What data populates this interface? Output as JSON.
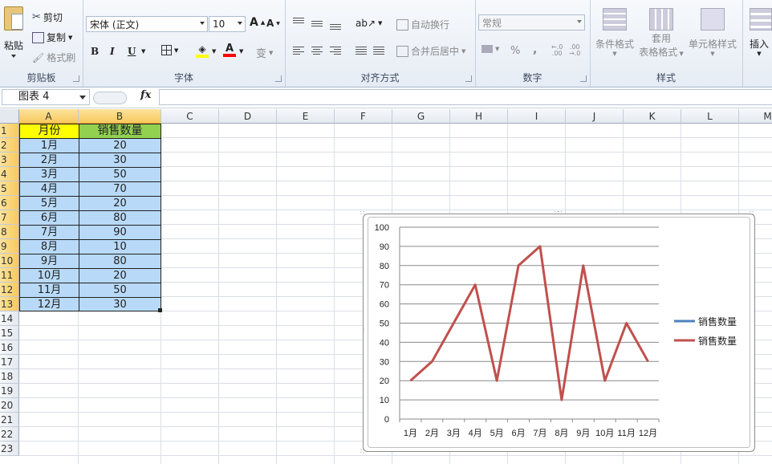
{
  "ribbon": {
    "clipboard": {
      "paste": "粘贴",
      "cut": "剪切",
      "copy": "复制",
      "format_painter": "格式刷",
      "group": "剪贴板"
    },
    "font": {
      "name": "宋体 (正文)",
      "size": "10",
      "bold": "B",
      "italic": "I",
      "underline": "U",
      "phonetic": "变",
      "group": "字体",
      "fill_color": "#ffff00",
      "font_color": "#ff0000"
    },
    "alignment": {
      "wrap": "自动换行",
      "merge": "合并后居中",
      "group": "对齐方式"
    },
    "number": {
      "format": "常规",
      "percent": "%",
      "comma": ",",
      "group": "数字"
    },
    "styles": {
      "conditional": "条件格式",
      "table_line1": "套用",
      "table_line2": "表格格式",
      "cell_styles": "单元格样式",
      "group": "样式"
    },
    "cells": {
      "insert": "插入"
    }
  },
  "formula_bar": {
    "name_box": "图表 4",
    "fx": "fx",
    "formula": ""
  },
  "columns": [
    "A",
    "B",
    "C",
    "D",
    "E",
    "F",
    "G",
    "H",
    "I",
    "J",
    "K",
    "L",
    "M"
  ],
  "rows": [
    "1",
    "2",
    "3",
    "4",
    "5",
    "6",
    "7",
    "8",
    "9",
    "10",
    "11",
    "12",
    "13",
    "14",
    "15",
    "16",
    "17",
    "18",
    "19",
    "20",
    "21",
    "22",
    "23"
  ],
  "table": {
    "header": [
      "月份",
      "销售数量"
    ],
    "rows": [
      [
        "1月",
        "20"
      ],
      [
        "2月",
        "30"
      ],
      [
        "3月",
        "50"
      ],
      [
        "4月",
        "70"
      ],
      [
        "5月",
        "20"
      ],
      [
        "6月",
        "80"
      ],
      [
        "7月",
        "90"
      ],
      [
        "8月",
        "10"
      ],
      [
        "9月",
        "80"
      ],
      [
        "10月",
        "20"
      ],
      [
        "11月",
        "50"
      ],
      [
        "12月",
        "30"
      ]
    ],
    "header_colors": [
      "#ffff00",
      "#92d050"
    ],
    "body_color": "#b8daf8"
  },
  "chart_data": {
    "type": "line",
    "categories": [
      "1月",
      "2月",
      "3月",
      "4月",
      "5月",
      "6月",
      "7月",
      "8月",
      "9月",
      "10月",
      "11月",
      "12月"
    ],
    "series": [
      {
        "name": "销售数量",
        "color": "#4f81bd",
        "values": []
      },
      {
        "name": "销售数量",
        "color": "#c0504d",
        "values": [
          20,
          30,
          50,
          70,
          20,
          80,
          90,
          10,
          80,
          20,
          50,
          30
        ]
      }
    ],
    "ylim": [
      0,
      100
    ],
    "yticks": [
      "0",
      "10",
      "20",
      "30",
      "40",
      "50",
      "60",
      "70",
      "80",
      "90",
      "100"
    ],
    "grid": true,
    "legend": "right",
    "title": "",
    "xlabel": "",
    "ylabel": ""
  }
}
